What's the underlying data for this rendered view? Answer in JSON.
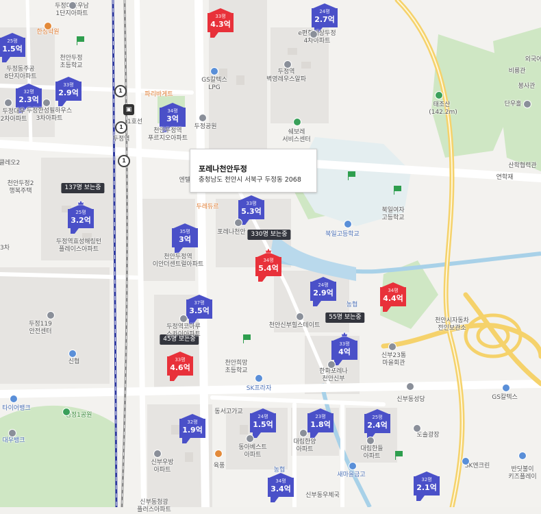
{
  "popup": {
    "title": "포레나천안두정",
    "address": "충청남도 천안시 서북구 두정동 2068"
  },
  "markers": [
    {
      "area": "33평",
      "price": "4.3억",
      "color": "red",
      "crown": false
    },
    {
      "area": "24평",
      "price": "2.7억",
      "color": "blue",
      "crown": false
    },
    {
      "area": "25평",
      "price": "1.5억",
      "color": "blue",
      "crown": false
    },
    {
      "area": "33평",
      "price": "2.9억",
      "color": "blue",
      "crown": false
    },
    {
      "area": "32평",
      "price": "2.3억",
      "color": "blue",
      "crown": false
    },
    {
      "area": "34평",
      "price": "3억",
      "color": "blue",
      "crown": false
    },
    {
      "area": "25평",
      "price": "3.2억",
      "color": "blue",
      "crown": true
    },
    {
      "area": "33평",
      "price": "5.3억",
      "color": "blue",
      "crown": false
    },
    {
      "area": "35평",
      "price": "3억",
      "color": "blue",
      "crown": false
    },
    {
      "area": "34평",
      "price": "5.4억",
      "color": "red",
      "crown": true
    },
    {
      "area": "24평",
      "price": "2.9억",
      "color": "blue",
      "crown": false
    },
    {
      "area": "34평",
      "price": "4.4억",
      "color": "red",
      "crown": false
    },
    {
      "area": "37평",
      "price": "3.5억",
      "color": "blue",
      "crown": false
    },
    {
      "area": "33평",
      "price": "4억",
      "color": "blue",
      "crown": true
    },
    {
      "area": "33평",
      "price": "4.6억",
      "color": "red",
      "crown": false
    },
    {
      "area": "32평",
      "price": "1.9억",
      "color": "blue",
      "crown": false
    },
    {
      "area": "24평",
      "price": "1.5억",
      "color": "blue",
      "crown": false
    },
    {
      "area": "23평",
      "price": "1.8억",
      "color": "blue",
      "crown": false
    },
    {
      "area": "25평",
      "price": "2.4억",
      "color": "blue",
      "crown": false
    },
    {
      "area": "34평",
      "price": "3.4억",
      "color": "blue",
      "crown": false
    },
    {
      "area": "32평",
      "price": "2.1억",
      "color": "blue",
      "crown": false
    }
  ],
  "viewers": [
    "137명 보는중",
    "330명 보는중",
    "55명 보는중",
    "45명 보는중"
  ],
  "labels": [
    "두정마을우남\n1단지아파트",
    "e편한세상두정\n4차아파트",
    "한성학원",
    "천안두정\n초등학교",
    "두정동주공\n8단지아파트",
    "두정대우\n2차아파트",
    "두정한성필하우스\n3차아파트",
    "GS칼텍스\nLPG",
    "두정역\n벽영레우스알파",
    "파리바게트",
    "두정공원",
    "쉐보레\n서비스센터",
    "천안두정역\n푸르지오아파트",
    "두정역",
    "1호선",
    "클레오2",
    "천안두정2\n행복주택",
    "두정역효성해링턴\n플레이스아파트",
    "포레나천안",
    "북일고등학교",
    "북일여자\n고등학교",
    "천안두정역\n이안더센트럴아파트",
    "천안신부힐스테이트",
    "두정119\n안전센터",
    "두정역코아루\n스카이아파트",
    "신협",
    "천안희망\n초등학교",
    "SK프라자",
    "한화포레나\n천안신부",
    "신부23통\n마을회관",
    "신부동성당",
    "천안시자동차\n전인보관소",
    "GS칼텍스",
    "동서고가교",
    "타이어뱅크",
    "성정1공원",
    "대우뱅크",
    "동아베스트\n아파트",
    "대림한양\n아파트",
    "대림한들\n아파트",
    "도솔광장",
    "신부우방\n아파트",
    "육풍",
    "농협",
    "새마을금고",
    "SK엔크린",
    "반딧불이\n키즈플레이",
    "신부동우체국",
    "신부동청광\n플러스아파트",
    "태조산",
    "외국어",
    "비룡관",
    "봉사관",
    "단우홀",
    "산학협력관",
    "연학재",
    "(142.2m)",
    "농협",
    "두레듀르",
    "3차",
    "엔텔리엔"
  ]
}
